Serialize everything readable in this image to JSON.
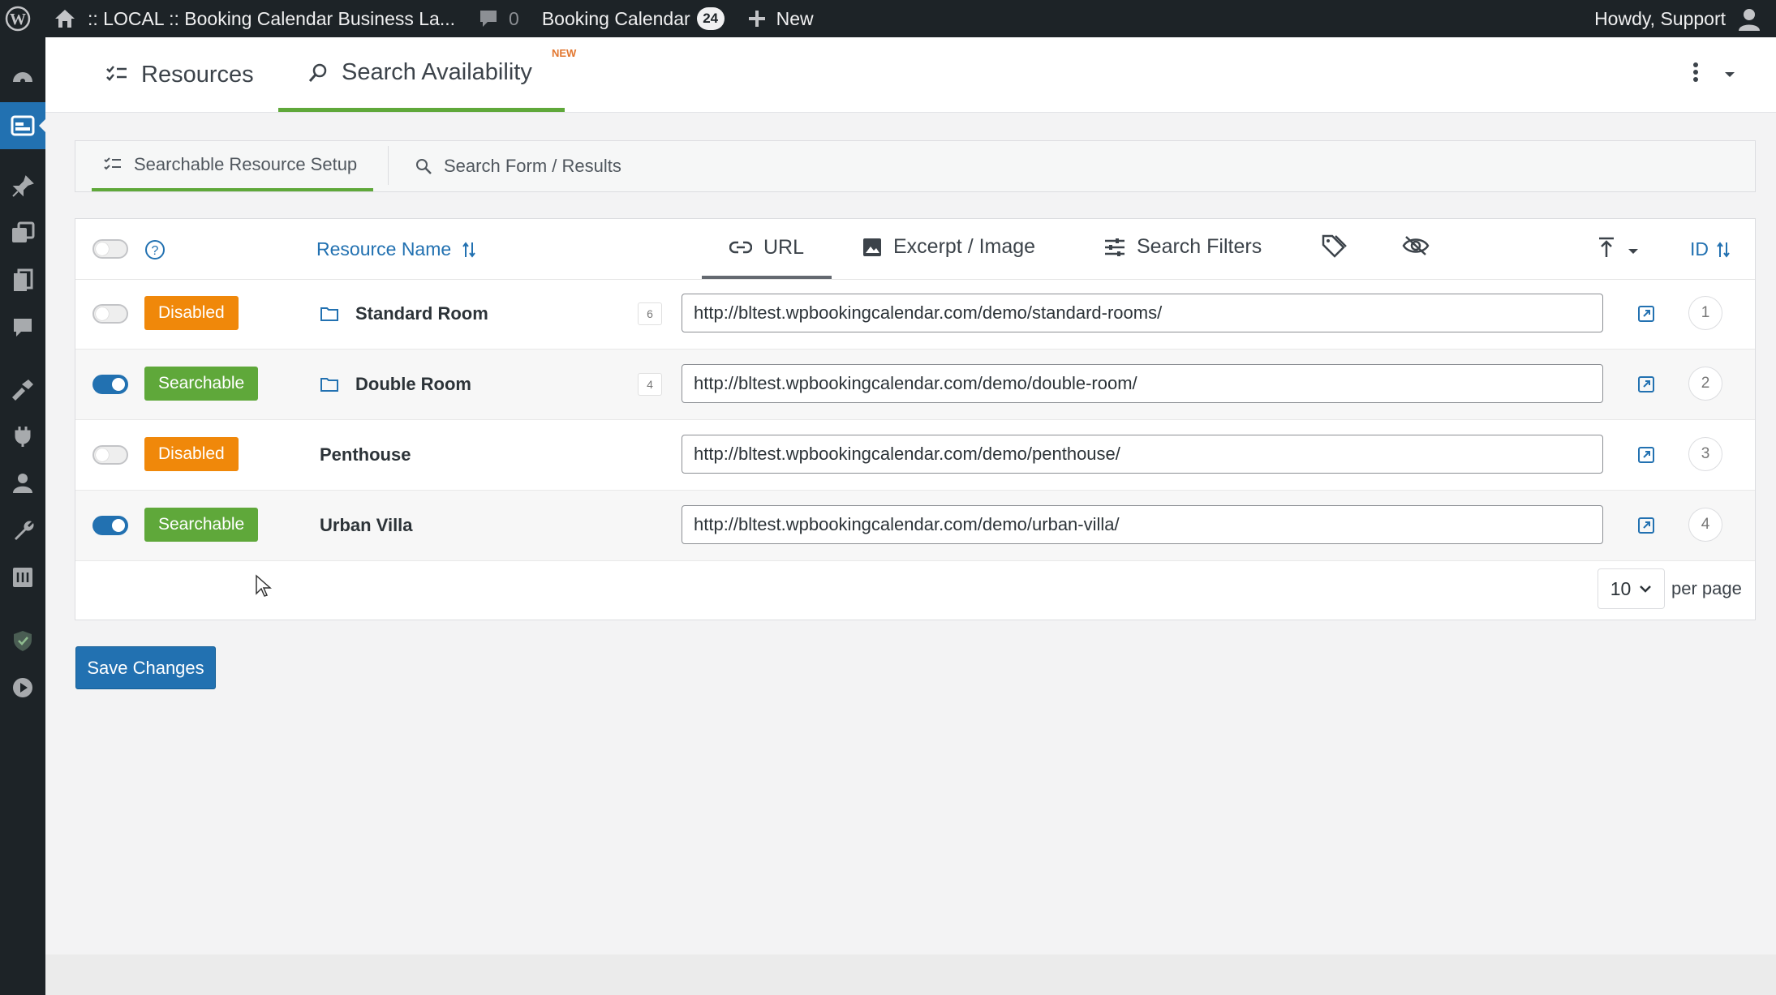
{
  "adminbar": {
    "site_title": ":: LOCAL :: Booking Calendar Business La...",
    "comments_count": "0",
    "plugin_label": "Booking Calendar",
    "plugin_count": "24",
    "new_label": "New",
    "howdy": "Howdy, Support"
  },
  "topnav": {
    "tabs": [
      {
        "label": "Resources",
        "icon": "checklist-icon"
      },
      {
        "label": "Search Availability",
        "icon": "search-icon",
        "badge": "NEW",
        "active": true
      }
    ]
  },
  "subtabs": [
    {
      "label": "Searchable Resource Setup",
      "icon": "checklist-icon",
      "active": true
    },
    {
      "label": "Search Form / Results",
      "icon": "search-icon"
    }
  ],
  "table": {
    "headers": {
      "resource_name": "Resource Name",
      "url": "URL",
      "excerpt_image": "Excerpt / Image",
      "search_filters": "Search Filters",
      "id": "ID"
    },
    "rows": [
      {
        "status": "Disabled",
        "enabled": false,
        "folder": true,
        "name": "Standard Room",
        "count": "6",
        "url": "http://bltest.wpbookingcalendar.com/demo/standard-rooms/",
        "id": "1"
      },
      {
        "status": "Searchable",
        "enabled": true,
        "folder": true,
        "name": "Double Room",
        "count": "4",
        "url": "http://bltest.wpbookingcalendar.com/demo/double-room/",
        "id": "2"
      },
      {
        "status": "Disabled",
        "enabled": false,
        "folder": false,
        "name": "Penthouse",
        "count": "",
        "url": "http://bltest.wpbookingcalendar.com/demo/penthouse/",
        "id": "3"
      },
      {
        "status": "Searchable",
        "enabled": true,
        "folder": false,
        "name": "Urban Villa",
        "count": "",
        "url": "http://bltest.wpbookingcalendar.com/demo/urban-villa/",
        "id": "4"
      }
    ],
    "per_page_value": "10",
    "per_page_label": "per page"
  },
  "save_button": "Save Changes",
  "colors": {
    "accent_blue": "#2271b1",
    "active_green": "#5fa83a",
    "disabled_orange": "#f0880a",
    "adminbar_bg": "#1d2327"
  }
}
